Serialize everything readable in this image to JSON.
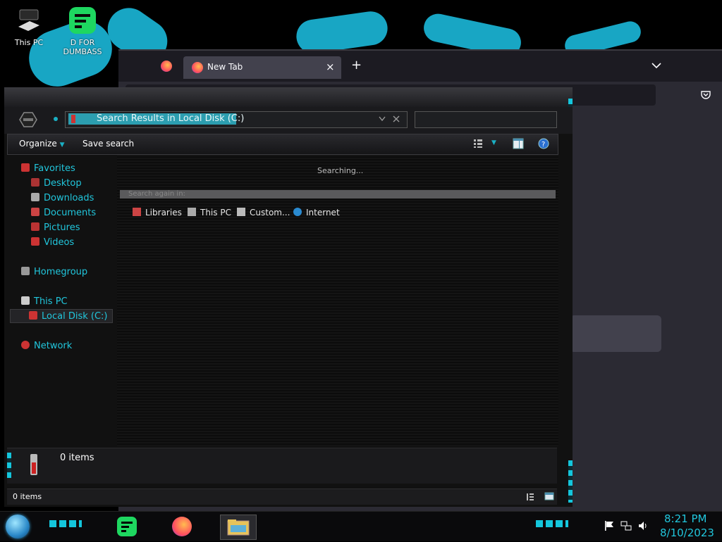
{
  "desktop": {
    "icons": [
      {
        "label": "This PC",
        "icon": "this-pc-icon"
      },
      {
        "label": "D FOR DUMBASS",
        "icon": "spotify-icon"
      }
    ]
  },
  "browser": {
    "tab_label": "New Tab",
    "close_tab_icon": "×",
    "new_tab_icon": "+",
    "list_tabs_icon": "chevron-down-icon"
  },
  "explorer": {
    "address": "Search Results in Local Disk (C:)",
    "toolbar": {
      "organize": "Organize",
      "save_search": "Save search"
    },
    "nav": {
      "favorites": "Favorites",
      "desktop": "Desktop",
      "downloads": "Downloads",
      "documents": "Documents",
      "pictures": "Pictures",
      "videos": "Videos",
      "homegroup": "Homegroup",
      "this_pc": "This PC",
      "local_disk": "Local Disk (C:)",
      "network": "Network"
    },
    "content": {
      "searching": "Searching...",
      "search_again": "Search again in:",
      "locations": [
        "Libraries",
        "This PC",
        "Custom...",
        "Internet"
      ]
    },
    "details": {
      "count": "0 items"
    },
    "status": {
      "count": "0 items"
    }
  },
  "taskbar": {
    "time": "8:21 PM",
    "date": "8/10/2023"
  }
}
